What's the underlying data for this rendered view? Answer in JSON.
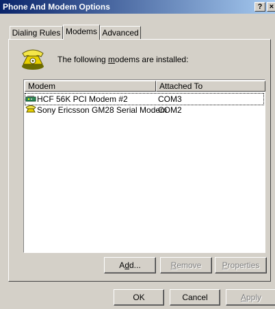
{
  "window": {
    "title": "Phone And Modem Options",
    "help_label": "?",
    "close_label": "×"
  },
  "tabs": [
    {
      "label": "Dialing Rules",
      "active": false
    },
    {
      "label": "Modems",
      "active": true
    },
    {
      "label": "Advanced",
      "active": false
    }
  ],
  "modems_tab": {
    "info_prefix": "The following ",
    "info_underlined": "m",
    "info_suffix": "odems are  installed:",
    "icon": "telephone-icon",
    "columns": [
      "Modem",
      "Attached To"
    ],
    "rows": [
      {
        "icon": "modem-icon",
        "modem": "HCF 56K PCI Modem #2",
        "attached_to": "COM3",
        "focused": true
      },
      {
        "icon": "phone-modem-icon",
        "modem": "Sony Ericsson GM28 Serial Modem",
        "attached_to": "COM2",
        "focused": false
      }
    ],
    "add_button": {
      "pre": "A",
      "accel": "d",
      "post": "d...",
      "enabled": true
    },
    "remove_button": {
      "pre": "",
      "accel": "R",
      "post": "emove",
      "enabled": false
    },
    "properties_button": {
      "pre": "",
      "accel": "P",
      "post": "roperties",
      "enabled": false
    }
  },
  "footer": {
    "ok_label": "OK",
    "cancel_label": "Cancel",
    "apply_pre": "",
    "apply_accel": "A",
    "apply_post": "pply",
    "apply_enabled": false
  }
}
